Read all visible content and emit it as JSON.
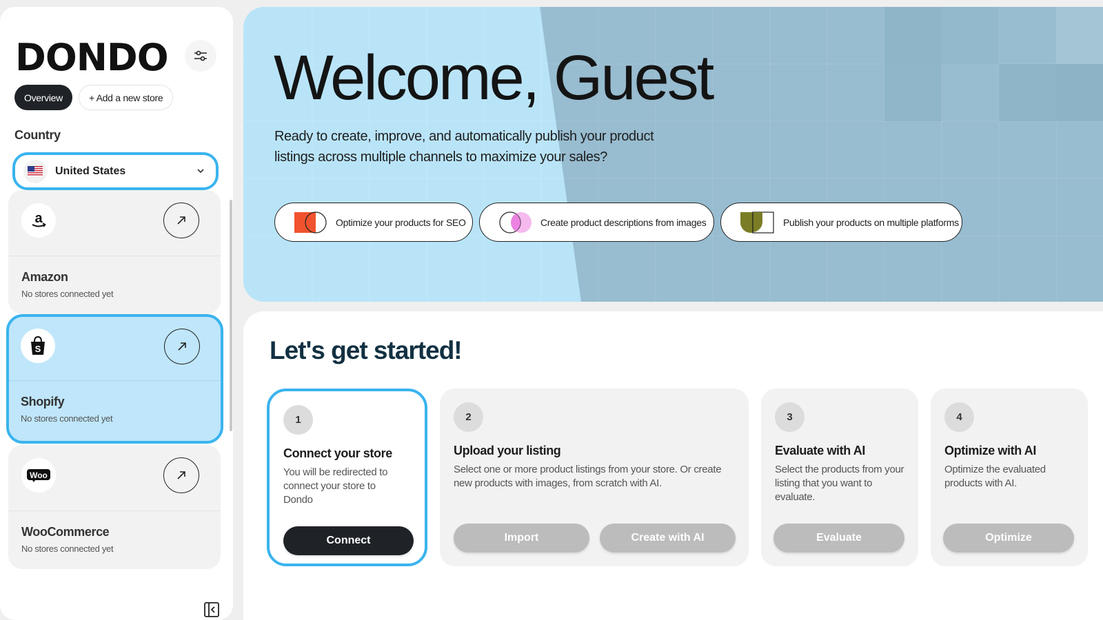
{
  "sidebar": {
    "logo": "DONDO",
    "tabs": {
      "overview": "Overview",
      "add_store": "+ Add a new store"
    },
    "country_label": "Country",
    "country_value": "United States",
    "stores": [
      {
        "name": "Amazon",
        "status": "No stores connected yet",
        "icon": "amazon-icon"
      },
      {
        "name": "Shopify",
        "status": "No stores connected yet",
        "icon": "shopify-icon"
      },
      {
        "name": "WooCommerce",
        "status": "No stores connected yet",
        "icon": "woocommerce-icon"
      }
    ],
    "woo_logo_text": "Woo"
  },
  "hero": {
    "title": "Welcome, Guest",
    "subtitle": "Ready to create, improve, and automatically publish your product listings across multiple channels to maximize your sales?",
    "features": [
      "Optimize your products for SEO",
      "Create product descriptions from images",
      "Publish your products on multiple platforms"
    ]
  },
  "main": {
    "heading": "Let's get started!",
    "steps": [
      {
        "num": "1",
        "title": "Connect your store",
        "desc": "You will be redirected to connect your store to Dondo",
        "buttons": [
          "Connect"
        ]
      },
      {
        "num": "2",
        "title": "Upload your listing",
        "desc": "Select one or more product listings from your store. Or create new products with images, from scratch with AI.",
        "buttons": [
          "Import",
          "Create with AI"
        ]
      },
      {
        "num": "3",
        "title": "Evaluate with AI",
        "desc": "Select the products from your listing that you want to evaluate.",
        "buttons": [
          "Evaluate"
        ]
      },
      {
        "num": "4",
        "title": "Optimize with AI",
        "desc": "Optimize the evaluated products with AI.",
        "buttons": [
          "Optimize"
        ]
      }
    ]
  },
  "colors": {
    "accent": "#3ab4ee",
    "hero_bg": "#b9e4f8",
    "hero_overlay": "#98bcd0",
    "dark_button": "#1f2328",
    "disabled_button": "#bcbcbc",
    "heading": "#123142"
  }
}
